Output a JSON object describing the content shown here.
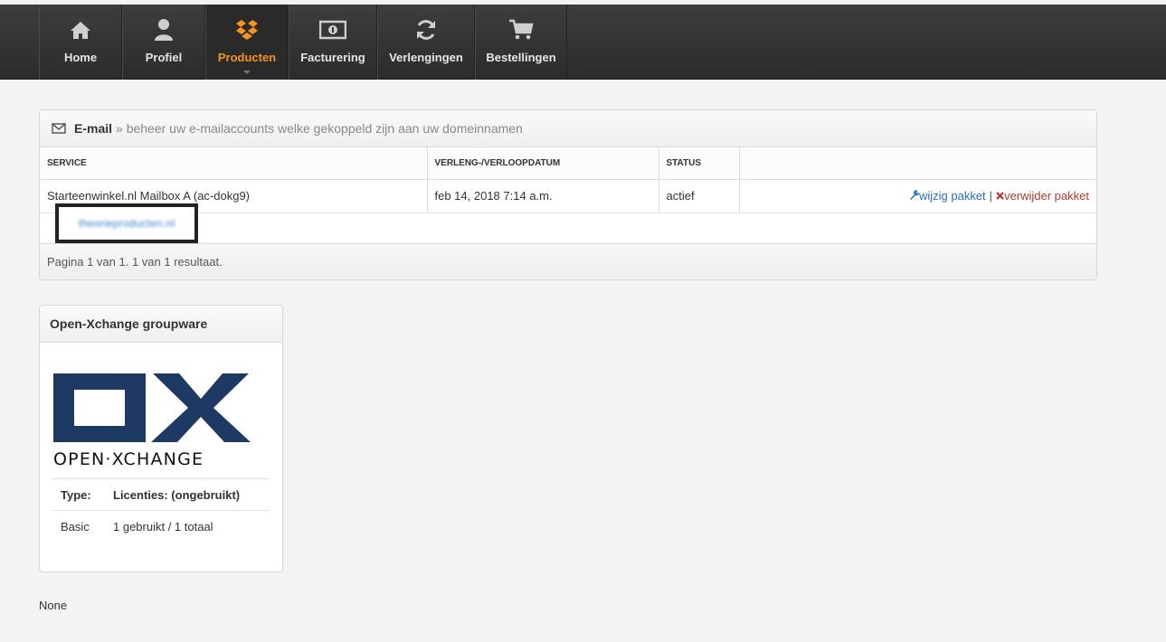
{
  "nav": {
    "items": [
      {
        "label": "Home",
        "icon": "home-icon"
      },
      {
        "label": "Profiel",
        "icon": "user-icon"
      },
      {
        "label": "Producten",
        "icon": "dropbox-icon",
        "active": true
      },
      {
        "label": "Facturering",
        "icon": "banknote-icon"
      },
      {
        "label": "Verlengingen",
        "icon": "refresh-icon"
      },
      {
        "label": "Bestellingen",
        "icon": "cart-icon"
      }
    ],
    "active_color": "#f7941e"
  },
  "email_panel": {
    "title": "E-mail",
    "subtitle": "» beheer uw e-mailaccounts welke gekoppeld zijn aan uw domeinnamen",
    "columns": [
      "SERVICE",
      "VERLENG-/VERLOOPDATUM",
      "STATUS",
      ""
    ],
    "rows": [
      {
        "service": "Starteenwinkel.nl Mailbox A (ac-dokg9)",
        "date": "feb 14, 2018 7:14 a.m.",
        "status": "actief",
        "edit_label": "wijzig pakket",
        "delete_label": "verwijder pakket",
        "separator": "|"
      }
    ],
    "domain": "theorieproducten.nl",
    "pagination": "Pagina 1 van 1. 1 van 1 resultaat."
  },
  "ox_panel": {
    "title": "Open-Xchange groupware",
    "logo_text": "OPEN·XCHANGE",
    "table": {
      "header": [
        "Type:",
        "Licenties: (ongebruikt)"
      ],
      "rows": [
        [
          "Basic",
          "1 gebruikt / 1 totaal"
        ]
      ]
    }
  },
  "footer_text": "None"
}
